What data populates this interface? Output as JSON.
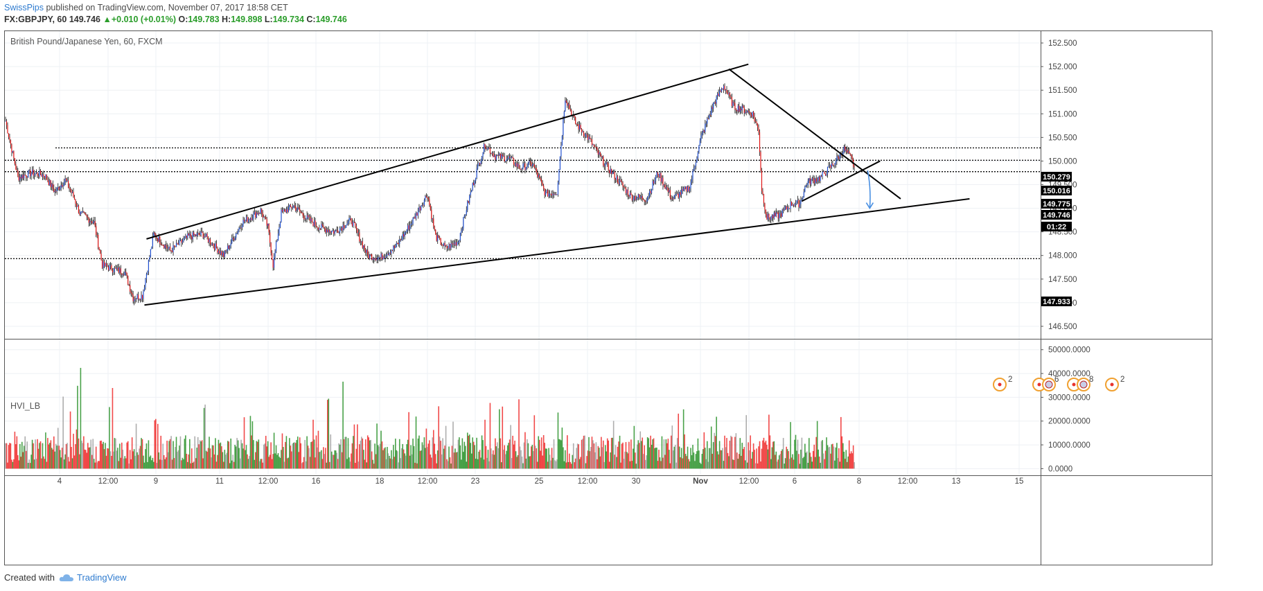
{
  "header": {
    "author": "SwissPips",
    "published_text": "published on TradingView.com, November 07, 2017 18:58 CET"
  },
  "quote": {
    "symbol": "FX:GBPJPY, 60",
    "last": "149.746",
    "change": "+0.010 (+0.01%)",
    "o_label": "O:",
    "o": "149.783",
    "h_label": "H:",
    "h": "149.898",
    "l_label": "L:",
    "l": "149.734",
    "c_label": "C:",
    "c": "149.746"
  },
  "footer": {
    "created_with": "Created with",
    "brand": "TradingView"
  },
  "colors": {
    "up": "#1f4fd1",
    "down": "#e01414",
    "wick": "#111111",
    "vol_green": "#1a8a1a",
    "vol_red": "#ee1c1c",
    "vol_gray": "#999999",
    "grid": "#eef0f4",
    "accent_blue": "#2e7bcf"
  },
  "chart_data": {
    "type": "candlestick",
    "price_pane": {
      "title": "British Pound/Japanese Yen, 60, FXCM",
      "y_ticks": [
        "152.500",
        "152.000",
        "151.500",
        "151.000",
        "150.500",
        "150.000",
        "149.500",
        "149.000",
        "148.500",
        "148.000",
        "147.500",
        "147.000",
        "146.500"
      ],
      "y_range": [
        146.25,
        152.75
      ],
      "price_tags": [
        {
          "value": "150.279"
        },
        {
          "value": "150.016"
        },
        {
          "value": "149.775"
        },
        {
          "value": "149.746"
        },
        {
          "value": "01:22",
          "kind": "countdown"
        },
        {
          "value": "147.933"
        }
      ],
      "horizontal_levels": [
        150.279,
        150.016,
        149.775,
        147.933
      ],
      "waypoints": [
        [
          0,
          150.85
        ],
        [
          4,
          150.45
        ],
        [
          12,
          149.65
        ],
        [
          25,
          149.75
        ],
        [
          38,
          149.7
        ],
        [
          48,
          149.35
        ],
        [
          58,
          149.6
        ],
        [
          66,
          149.25
        ],
        [
          72,
          148.9
        ],
        [
          86,
          148.7
        ],
        [
          94,
          147.8
        ],
        [
          106,
          147.7
        ],
        [
          116,
          147.65
        ],
        [
          124,
          147.1
        ],
        [
          133,
          147.15
        ],
        [
          144,
          148.45
        ],
        [
          160,
          148.1
        ],
        [
          178,
          148.4
        ],
        [
          192,
          148.45
        ],
        [
          212,
          148.0
        ],
        [
          230,
          148.7
        ],
        [
          248,
          148.95
        ],
        [
          255,
          148.6
        ],
        [
          260,
          147.8
        ],
        [
          268,
          148.9
        ],
        [
          280,
          149.05
        ],
        [
          292,
          148.8
        ],
        [
          305,
          148.6
        ],
        [
          320,
          148.5
        ],
        [
          336,
          148.75
        ],
        [
          352,
          148.0
        ],
        [
          364,
          147.95
        ],
        [
          380,
          148.2
        ],
        [
          396,
          148.75
        ],
        [
          410,
          149.3
        ],
        [
          418,
          148.4
        ],
        [
          428,
          148.15
        ],
        [
          440,
          148.3
        ],
        [
          448,
          149.0
        ],
        [
          458,
          149.8
        ],
        [
          466,
          150.35
        ],
        [
          476,
          150.1
        ],
        [
          490,
          150.05
        ],
        [
          500,
          149.85
        ],
        [
          512,
          149.95
        ],
        [
          525,
          149.3
        ],
        [
          536,
          149.35
        ],
        [
          541,
          150.6
        ],
        [
          544,
          151.35
        ],
        [
          554,
          150.8
        ],
        [
          566,
          150.5
        ],
        [
          582,
          149.95
        ],
        [
          595,
          149.6
        ],
        [
          608,
          149.25
        ],
        [
          623,
          149.2
        ],
        [
          634,
          149.75
        ],
        [
          648,
          149.2
        ],
        [
          665,
          149.45
        ],
        [
          676,
          150.5
        ],
        [
          688,
          151.2
        ],
        [
          698,
          151.6
        ],
        [
          708,
          151.15
        ],
        [
          716,
          151.1
        ],
        [
          726,
          151.0
        ],
        [
          732,
          150.65
        ],
        [
          735,
          149.4
        ],
        [
          740,
          148.8
        ],
        [
          752,
          148.85
        ],
        [
          764,
          149.1
        ],
        [
          772,
          149.1
        ],
        [
          779,
          149.55
        ],
        [
          792,
          149.65
        ],
        [
          805,
          149.95
        ],
        [
          815,
          150.25
        ],
        [
          822,
          150.05
        ],
        [
          826,
          149.8
        ]
      ],
      "trendlines": [
        {
          "name": "upper-channel",
          "points": [
            [
              137,
              148.35
            ],
            [
              722,
              152.05
            ]
          ]
        },
        {
          "name": "lower-channel",
          "points": [
            [
              135,
              146.95
            ],
            [
              937,
              149.2
            ]
          ]
        },
        {
          "name": "descending-resistance",
          "points": [
            [
              703,
              151.95
            ],
            [
              870,
              149.2
            ]
          ]
        },
        {
          "name": "wedge-support",
          "points": [
            [
              774,
              149.15
            ],
            [
              850,
              150.0
            ]
          ]
        }
      ],
      "forecast_arrow": {
        "from": [
          840,
          149.8
        ],
        "to": [
          840,
          149.0
        ]
      },
      "event_badges": [
        "2",
        "6",
        "8",
        "2"
      ]
    },
    "volume_pane": {
      "title": "HVI_LB",
      "y_ticks": [
        "50000.0000",
        "40000.0000",
        "30000.0000",
        "20000.0000",
        "10000.0000",
        "0.0000"
      ],
      "y_range": [
        -2500,
        54000
      ]
    },
    "x_axis": {
      "ticks": [
        {
          "label": "4"
        },
        {
          "label": "12:00"
        },
        {
          "label": "9"
        },
        {
          "label": "11"
        },
        {
          "label": "12:00"
        },
        {
          "label": "16"
        },
        {
          "label": "18"
        },
        {
          "label": "12:00"
        },
        {
          "label": "23"
        },
        {
          "label": "25"
        },
        {
          "label": "12:00"
        },
        {
          "label": "30"
        },
        {
          "label": "Nov"
        },
        {
          "label": "12:00"
        },
        {
          "label": "6"
        },
        {
          "label": "8"
        },
        {
          "label": "12:00"
        },
        {
          "label": "13"
        },
        {
          "label": "15"
        }
      ]
    }
  }
}
